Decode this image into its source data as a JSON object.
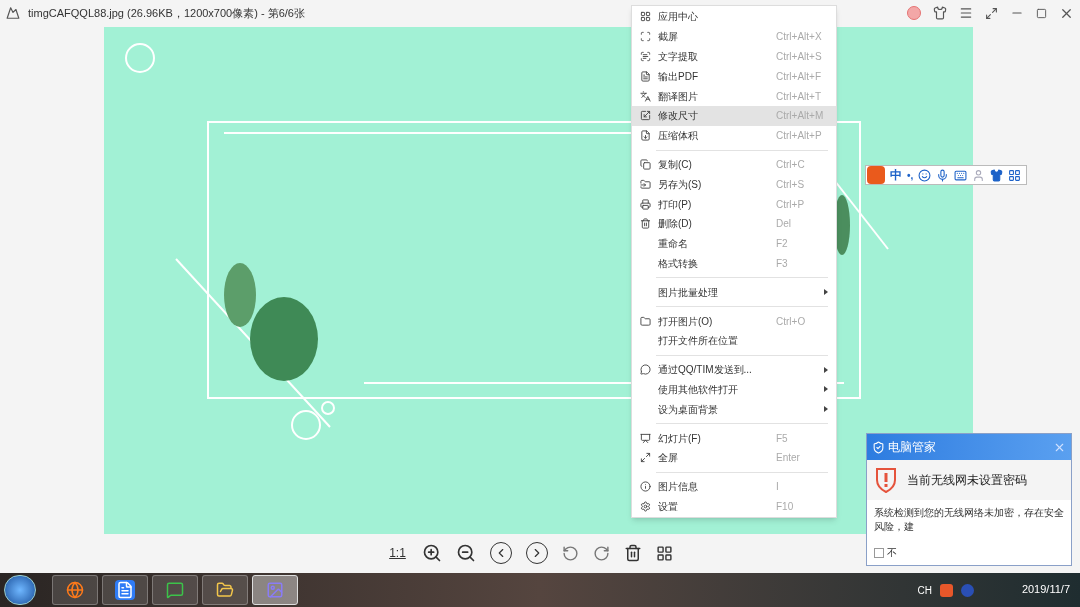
{
  "window": {
    "title": "timgCAFQQL88.jpg (26.96KB，1200x700像素) - 第6/6张"
  },
  "toolbar": {
    "actual_size": "1:1"
  },
  "context_menu": [
    {
      "kind": "item",
      "label": "应用中心",
      "selected": false
    },
    {
      "kind": "item",
      "label": "截屏",
      "shortcut": "Ctrl+Alt+X",
      "selected": false
    },
    {
      "kind": "item",
      "label": "文字提取",
      "shortcut": "Ctrl+Alt+S",
      "selected": false
    },
    {
      "kind": "item",
      "label": "输出PDF",
      "shortcut": "Ctrl+Alt+F",
      "selected": false
    },
    {
      "kind": "item",
      "label": "翻译图片",
      "shortcut": "Ctrl+Alt+T",
      "selected": false
    },
    {
      "kind": "item",
      "label": "修改尺寸",
      "shortcut": "Ctrl+Alt+M",
      "selected": true
    },
    {
      "kind": "item",
      "label": "压缩体积",
      "shortcut": "Ctrl+Alt+P",
      "selected": false
    },
    {
      "kind": "separator"
    },
    {
      "kind": "item",
      "label": "复制(C)",
      "shortcut": "Ctrl+C",
      "selected": false
    },
    {
      "kind": "item",
      "label": "另存为(S)",
      "shortcut": "Ctrl+S",
      "selected": false
    },
    {
      "kind": "item",
      "label": "打印(P)",
      "shortcut": "Ctrl+P",
      "selected": false
    },
    {
      "kind": "item",
      "label": "删除(D)",
      "shortcut": "Del",
      "selected": false
    },
    {
      "kind": "item",
      "label": "重命名",
      "shortcut": "F2",
      "selected": false
    },
    {
      "kind": "item",
      "label": "格式转换",
      "shortcut": "F3",
      "selected": false
    },
    {
      "kind": "separator"
    },
    {
      "kind": "submenu",
      "label": "图片批量处理",
      "selected": false
    },
    {
      "kind": "separator"
    },
    {
      "kind": "item",
      "label": "打开图片(O)",
      "shortcut": "Ctrl+O",
      "selected": false
    },
    {
      "kind": "item",
      "label": "打开文件所在位置",
      "selected": false
    },
    {
      "kind": "separator"
    },
    {
      "kind": "submenu",
      "label": "通过QQ/TIM发送到...",
      "selected": false
    },
    {
      "kind": "submenu",
      "label": "使用其他软件打开",
      "selected": false
    },
    {
      "kind": "submenu",
      "label": "设为桌面背景",
      "selected": false
    },
    {
      "kind": "separator"
    },
    {
      "kind": "item",
      "label": "幻灯片(F)",
      "shortcut": "F5",
      "selected": false
    },
    {
      "kind": "item",
      "label": "全屏",
      "shortcut": "Enter",
      "selected": false
    },
    {
      "kind": "separator"
    },
    {
      "kind": "item",
      "label": "图片信息",
      "shortcut": "I",
      "selected": false
    },
    {
      "kind": "item",
      "label": "设置",
      "shortcut": "F10",
      "selected": false
    }
  ],
  "ime_bar": {
    "mode": "中",
    "punctuation": "•,"
  },
  "notification": {
    "app": "电脑管家",
    "headline": "当前无线网未设置密码",
    "body": "系统检测到您的无线网络未加密，存在安全风险，建",
    "checkbox_label": "不",
    "checked": false
  },
  "taskbar": {
    "apps": [
      {
        "kind": "firefox",
        "selected": false
      },
      {
        "kind": "wps",
        "selected": false
      },
      {
        "kind": "wechat",
        "selected": false
      },
      {
        "kind": "explorer",
        "selected": false
      },
      {
        "kind": "photos",
        "selected": true
      }
    ],
    "language": "CH",
    "date": "2019/11/7"
  }
}
